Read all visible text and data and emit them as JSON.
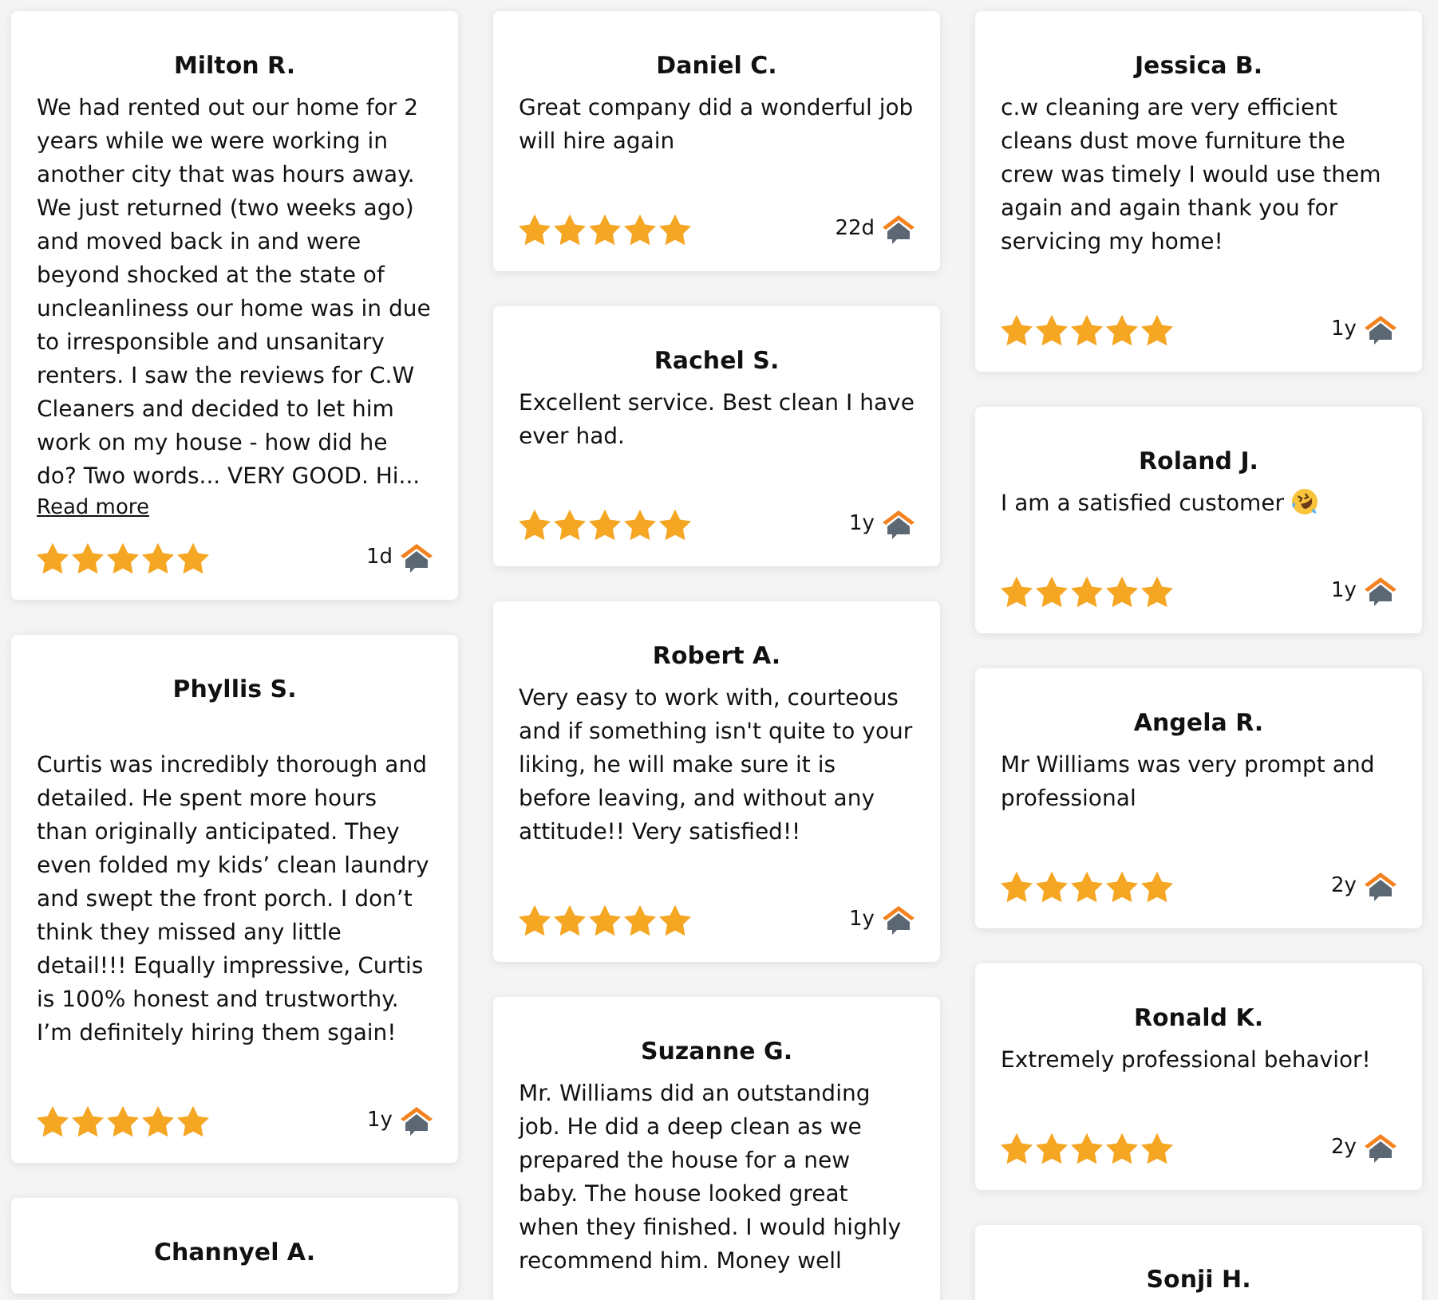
{
  "columns": [
    {
      "reviews": [
        {
          "name": "Milton R.",
          "text": "We had rented out our home for 2 years while we were working in another city that was hours away. We just returned (two weeks ago) and moved back in and were beyond shocked at the state of uncleanliness our home was in due to irresponsible and unsanitary renters. I saw the reviews for C.W Cleaners and decided to let him work on my house - how did he do? Two words... VERY GOOD. Hi...",
          "read_more": "Read more",
          "stars": 5,
          "age": "1d"
        },
        {
          "name": "Phyllis S.",
          "text": "\nCurtis was incredibly thorough and detailed. He spent more hours than originally anticipated. They even folded my kids’ clean laundry and swept the front porch. I don’t think they missed any little detail!!! Equally impressive, Curtis is 100% honest and trustworthy. I’m definitely hiring them sgain!",
          "stars": 5,
          "age": "1y"
        },
        {
          "name": "Channyel A."
        }
      ]
    },
    {
      "reviews": [
        {
          "name": "Daniel C.",
          "text": "Great company did a wonderful job will hire again",
          "stars": 5,
          "age": "22d"
        },
        {
          "name": "Rachel S.",
          "text": "Excellent service. Best clean I have ever had.",
          "stars": 5,
          "age": "1y"
        },
        {
          "name": "Robert A.",
          "text": "Very easy to work with, courteous and if something isn't quite to your liking, he will make sure it is before leaving, and without any attitude!! Very satisfied!!",
          "stars": 5,
          "age": "1y"
        },
        {
          "name": "Suzanne G.",
          "text": "Mr. Williams did an outstanding job. He did a deep clean as we prepared the house for a new baby. The house looked great when they finished. I would highly recommend him. Money well"
        }
      ]
    },
    {
      "reviews": [
        {
          "name": "Jessica B.",
          "text": "c.w cleaning are very efficient cleans dust move furniture the crew was timely I would use them again and again thank you for servicing my home!",
          "stars": 5,
          "age": "1y"
        },
        {
          "name": "Roland J.",
          "text": "I am a satisfied customer",
          "emoji": true,
          "stars": 5,
          "age": "1y"
        },
        {
          "name": "Angela R.",
          "text": "Mr Williams was very prompt and professional",
          "stars": 5,
          "age": "2y"
        },
        {
          "name": "Ronald K.",
          "text": "Extremely professional behavior!",
          "stars": 5,
          "age": "2y"
        },
        {
          "name": "Sonji H."
        }
      ]
    }
  ]
}
